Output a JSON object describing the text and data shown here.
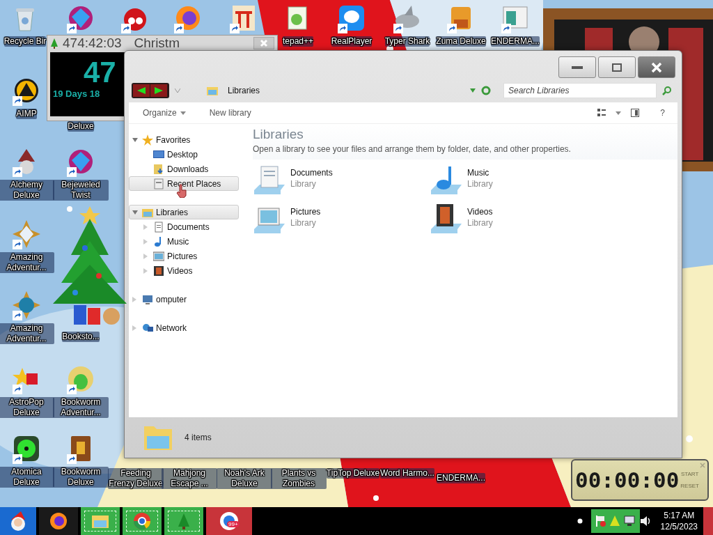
{
  "desktop_icons": [
    {
      "label": "Recycle Bir",
      "kind": "bin",
      "shortcut": false
    },
    {
      "kind": "gem",
      "shortcut": true
    },
    {
      "kind": "ball",
      "shortcut": true
    },
    {
      "kind": "browser",
      "shortcut": true
    },
    {
      "kind": "gate",
      "shortcut": true
    },
    {
      "label": "tepad++",
      "kind": "notepad",
      "shortcut": false
    },
    {
      "label": "RealPlayer",
      "kind": "player",
      "shortcut": true
    },
    {
      "label": "Typer Shark",
      "kind": "shark",
      "shortcut": true
    },
    {
      "label": "Zuma Deluxe",
      "kind": "block",
      "shortcut": true
    },
    {
      "label": "ENDERMA...",
      "kind": "window",
      "shortcut": true
    },
    {
      "label": "AIMP",
      "kind": "aimp",
      "shortcut": true
    },
    {
      "label": "Alchemy Deluxe",
      "kind": "wizard",
      "shortcut": true
    },
    {
      "label": "Amazing Adventur...",
      "kind": "compass",
      "shortcut": true
    },
    {
      "label": "Amazing Adventur...",
      "kind": "globe",
      "shortcut": true
    },
    {
      "label": "AstroPop Deluxe",
      "kind": "star",
      "shortcut": true
    },
    {
      "label": "Atomica Deluxe",
      "kind": "radiation",
      "shortcut": true
    },
    {
      "label": "Deluxe",
      "kind": "none",
      "shortcut": false
    },
    {
      "label": "Bejeweled Twist",
      "kind": "gem",
      "shortcut": true
    },
    {
      "label": "Booksto...",
      "kind": "none",
      "shortcut": false
    },
    {
      "label": "Bookworm Adventur...",
      "kind": "frog",
      "shortcut": true
    },
    {
      "label": "Bookworm Deluxe",
      "kind": "book",
      "shortcut": true
    },
    {
      "label": "Feeding Frenzy Deluxe",
      "kind": "none",
      "shortcut": false
    },
    {
      "label": "Mahjong Escape ...",
      "kind": "none",
      "shortcut": false
    },
    {
      "label": "Noah's Ark Deluxe",
      "kind": "none",
      "shortcut": false
    },
    {
      "label": "Plants vs Zombies",
      "kind": "none",
      "shortcut": false
    },
    {
      "label": "TipTop Deluxe",
      "kind": "none",
      "shortcut": false
    },
    {
      "label": "Word Harmo...",
      "kind": "none",
      "shortcut": false
    },
    {
      "label": "ENDERMA...",
      "kind": "none",
      "shortcut": false
    }
  ],
  "countdown_widget": {
    "countdown": "474:42:03",
    "title": "Christm",
    "number": "47",
    "days": "19 Days 18"
  },
  "explorer": {
    "address": "Libraries",
    "search": {
      "placeholder": "Search Libraries"
    },
    "toolbar": [
      {
        "label": "Organize",
        "dropdown": true
      },
      {
        "label": "New library",
        "dropdown": false
      }
    ],
    "help": "?",
    "nav": [
      {
        "label": "Favorites",
        "kind": "star",
        "expanded": true,
        "selected": false,
        "children": [
          {
            "label": "Desktop",
            "kind": "desktop",
            "selected": false
          },
          {
            "label": "Downloads",
            "kind": "downloads",
            "selected": false
          },
          {
            "label": "Recent Places",
            "kind": "recent",
            "selected": true
          }
        ]
      },
      {
        "label": "Libraries",
        "kind": "library",
        "expanded": true,
        "selected": true,
        "children": [
          {
            "label": "Documents",
            "kind": "documents",
            "selected": false
          },
          {
            "label": "Music",
            "kind": "music",
            "selected": false
          },
          {
            "label": "Pictures",
            "kind": "pictures",
            "selected": false
          },
          {
            "label": "Videos",
            "kind": "videos",
            "selected": false
          }
        ]
      },
      {
        "label": "omputer",
        "kind": "computer",
        "expanded": false,
        "selected": false
      },
      {
        "label": "Network",
        "kind": "network",
        "expanded": false,
        "selected": false
      }
    ],
    "heading": "Libraries",
    "description": "Open a library to see your files and arrange them by folder, date, and other properties.",
    "libraries": [
      {
        "name": "Documents",
        "type": "Library",
        "kind": "documents"
      },
      {
        "name": "Music",
        "type": "Library",
        "kind": "music"
      },
      {
        "name": "Pictures",
        "type": "Library",
        "kind": "pictures"
      },
      {
        "name": "Videos",
        "type": "Library",
        "kind": "videos"
      }
    ],
    "status": "4 items"
  },
  "stopwatch": {
    "time": "00:00:00",
    "buttons": [
      "START",
      "RESET"
    ]
  },
  "taskbar": {
    "buttons": [
      {
        "kind": "firefox",
        "highlighted": false
      },
      {
        "kind": "explorer",
        "highlighted": true
      },
      {
        "kind": "chrome",
        "highlighted": true
      },
      {
        "kind": "tree",
        "highlighted": true
      },
      {
        "kind": "chat",
        "highlighted": false,
        "badge": "99+"
      }
    ],
    "time": "5:17 AM",
    "date": "12/5/2023"
  }
}
